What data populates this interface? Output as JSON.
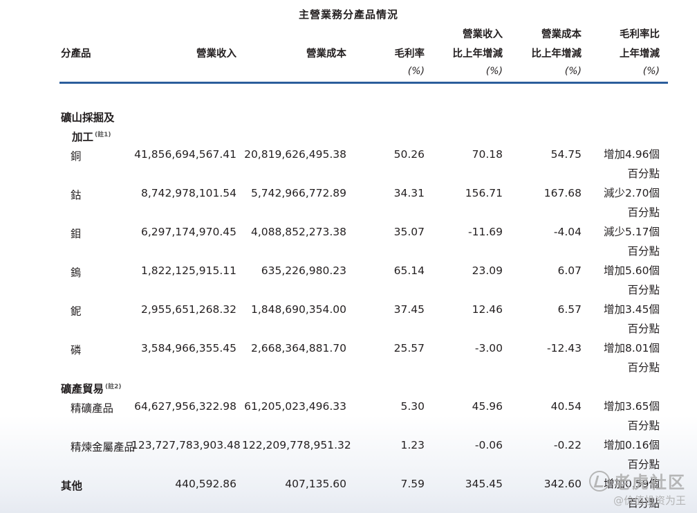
{
  "title": "主營業務分產品情況",
  "headers": {
    "product": "分產品",
    "revenue": "營業收入",
    "cost": "營業成本",
    "margin": "毛利率",
    "rev_change_1": "營業收入",
    "rev_change_2": "比上年增減",
    "cost_change_1": "營業成本",
    "cost_change_2": "比上年增減",
    "margin_change_1": "毛利率比",
    "margin_change_2": "上年增減",
    "unit": "(%)"
  },
  "section1": {
    "label_line1": "礦山採掘及",
    "label_line2": "加工",
    "note": "(註1)"
  },
  "section2": {
    "label": "礦產貿易",
    "note": "(註2)"
  },
  "rows": [
    {
      "name": "銅",
      "revenue": "41,856,694,567.41",
      "cost": "20,819,626,495.38",
      "margin": "50.26",
      "rev_chg": "70.18",
      "cost_chg": "54.75",
      "margin_chg": "增加4.96個",
      "margin_chg2": "百分點"
    },
    {
      "name": "鈷",
      "revenue": "8,742,978,101.54",
      "cost": "5,742,966,772.89",
      "margin": "34.31",
      "rev_chg": "156.71",
      "cost_chg": "167.68",
      "margin_chg": "減少2.70個",
      "margin_chg2": "百分點"
    },
    {
      "name": "鉬",
      "revenue": "6,297,174,970.45",
      "cost": "4,088,852,273.38",
      "margin": "35.07",
      "rev_chg": "-11.69",
      "cost_chg": "-4.04",
      "margin_chg": "減少5.17個",
      "margin_chg2": "百分點"
    },
    {
      "name": "鎢",
      "revenue": "1,822,125,915.11",
      "cost": "635,226,980.23",
      "margin": "65.14",
      "rev_chg": "23.09",
      "cost_chg": "6.07",
      "margin_chg": "增加5.60個",
      "margin_chg2": "百分點"
    },
    {
      "name": "鈮",
      "revenue": "2,955,651,268.32",
      "cost": "1,848,690,354.00",
      "margin": "37.45",
      "rev_chg": "12.46",
      "cost_chg": "6.57",
      "margin_chg": "增加3.45個",
      "margin_chg2": "百分點"
    },
    {
      "name": "磷",
      "revenue": "3,584,966,355.45",
      "cost": "2,668,364,881.70",
      "margin": "25.57",
      "rev_chg": "-3.00",
      "cost_chg": "-12.43",
      "margin_chg": "增加8.01個",
      "margin_chg2": "百分點"
    },
    {
      "name": "精礦產品",
      "revenue": "64,627,956,322.98",
      "cost": "61,205,023,496.33",
      "margin": "5.30",
      "rev_chg": "45.96",
      "cost_chg": "40.54",
      "margin_chg": "增加3.65個",
      "margin_chg2": "百分點"
    },
    {
      "name": "精煉金屬產品",
      "revenue": "123,727,783,903.48",
      "cost": "122,209,778,951.32",
      "margin": "1.23",
      "rev_chg": "-0.06",
      "cost_chg": "-0.22",
      "margin_chg": "增加0.16個",
      "margin_chg2": "百分點"
    },
    {
      "name": "其他",
      "revenue": "440,592.86",
      "cost": "407,135.60",
      "margin": "7.59",
      "rev_chg": "345.45",
      "cost_chg": "342.60",
      "margin_chg": "增加0.59個",
      "margin_chg2": "百分點"
    }
  ],
  "watermark": {
    "line1": "老虎社区",
    "line2": "@价值投资为王"
  }
}
